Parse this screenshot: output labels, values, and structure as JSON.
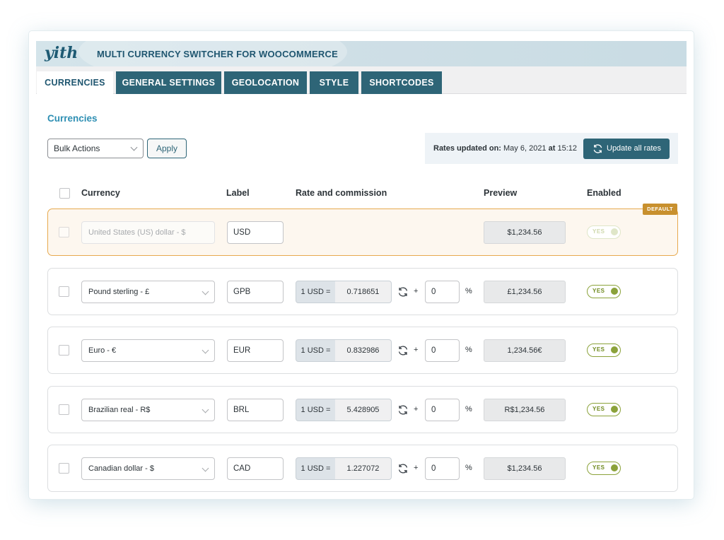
{
  "app": {
    "logo": "yith",
    "title": "MULTI CURRENCY SWITCHER FOR WOOCOMMERCE"
  },
  "tabs": [
    {
      "label": "CURRENCIES",
      "active": true
    },
    {
      "label": "GENERAL SETTINGS",
      "active": false
    },
    {
      "label": "GEOLOCATION",
      "active": false
    },
    {
      "label": "STYLE",
      "active": false
    },
    {
      "label": "SHORTCODES",
      "active": false
    }
  ],
  "section_title": "Currencies",
  "bulk": {
    "selected": "Bulk Actions",
    "apply_label": "Apply"
  },
  "rates_info": {
    "prefix": "Rates updated on:",
    "date": "May 6, 2021",
    "at": "at",
    "time": "15:12",
    "update_button": "Update all rates"
  },
  "table": {
    "headers": {
      "currency": "Currency",
      "label": "Label",
      "rate": "Rate and commission",
      "preview": "Preview",
      "enabled": "Enabled"
    },
    "default_badge": "DEFAULT",
    "rows": [
      {
        "currency": "United States (US) dollar - $",
        "label": "USD",
        "rate_prefix": "",
        "rate": "",
        "commission": "",
        "preview": "$1,234.56",
        "enabled": "YES",
        "default": true
      },
      {
        "currency": "Pound sterling - £",
        "label": "GPB",
        "rate_prefix": "1 USD =",
        "rate": "0.718651",
        "commission": "0",
        "preview": "£1,234.56",
        "enabled": "YES",
        "default": false
      },
      {
        "currency": "Euro - €",
        "label": "EUR",
        "rate_prefix": "1 USD =",
        "rate": "0.832986",
        "commission": "0",
        "preview": "1,234.56€",
        "enabled": "YES",
        "default": false
      },
      {
        "currency": "Brazilian real - R$",
        "label": "BRL",
        "rate_prefix": "1 USD =",
        "rate": "5.428905",
        "commission": "0",
        "preview": "R$1,234.56",
        "enabled": "YES",
        "default": false
      },
      {
        "currency": "Canadian dollar - $",
        "label": "CAD",
        "rate_prefix": "1 USD =",
        "rate": "1.227072",
        "commission": "0",
        "preview": "$1,234.56",
        "enabled": "YES",
        "default": false
      }
    ],
    "plus_sign": "+",
    "percent_sign": "%"
  },
  "colors": {
    "brand": "#2e6577",
    "accent": "#2e8fb3",
    "toggle_on": "#8ba23a",
    "default_badge": "#c8902e"
  }
}
